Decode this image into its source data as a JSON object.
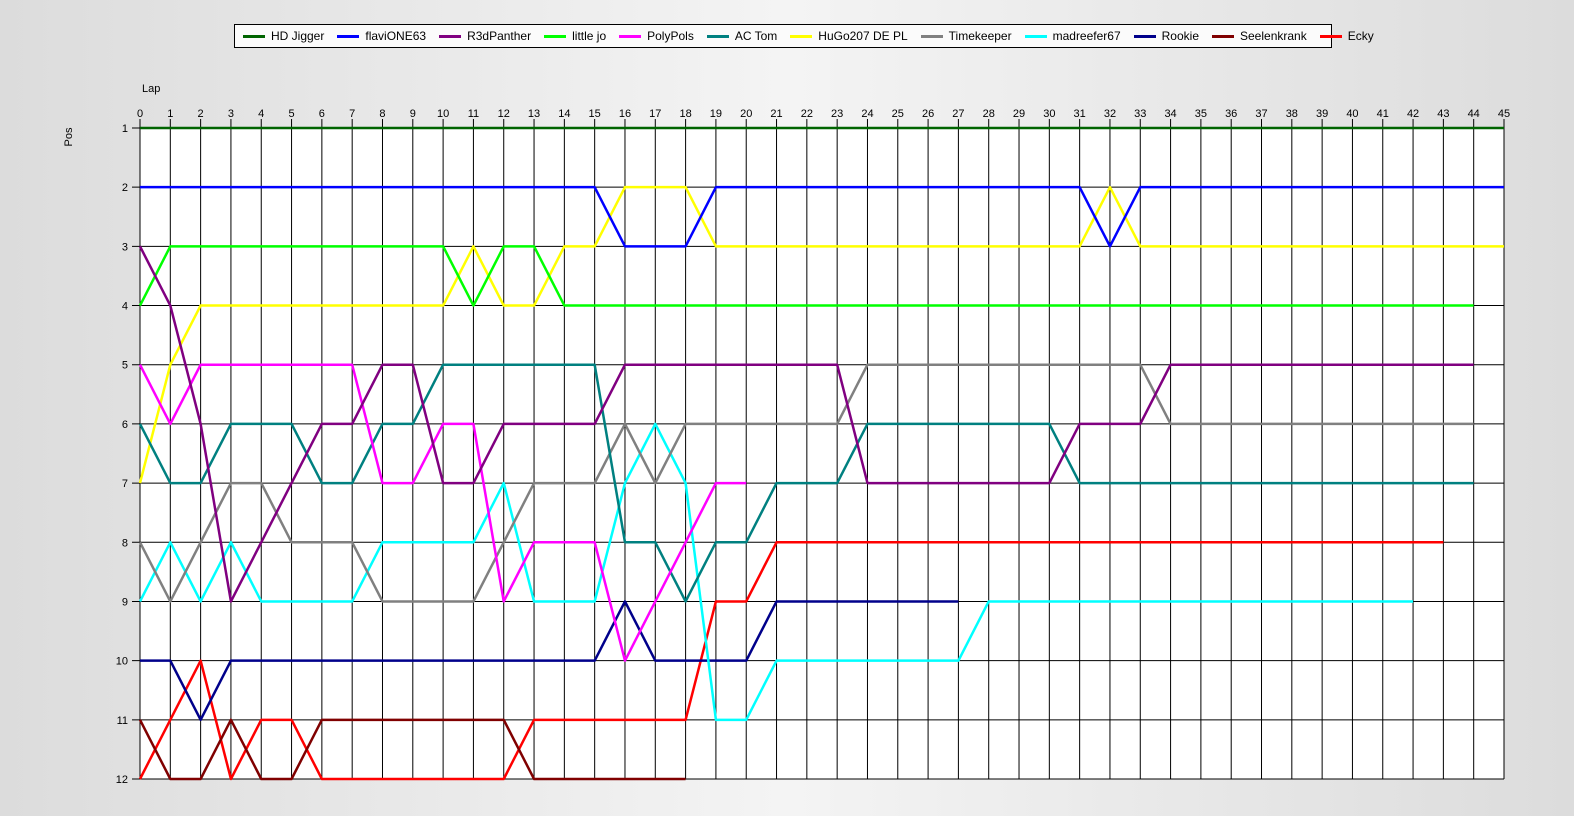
{
  "chart_data": {
    "type": "line",
    "title": "",
    "xlabel": "Lap",
    "ylabel": "Pos",
    "xlim": [
      0,
      45
    ],
    "ylim": [
      1,
      12
    ],
    "y_reversed": true,
    "grid": true,
    "legend_position": "top",
    "x_ticks": [
      0,
      1,
      2,
      3,
      4,
      5,
      6,
      7,
      8,
      9,
      10,
      11,
      12,
      13,
      14,
      15,
      16,
      17,
      18,
      19,
      20,
      21,
      22,
      23,
      24,
      25,
      26,
      27,
      28,
      29,
      30,
      31,
      32,
      33,
      34,
      35,
      36,
      37,
      38,
      39,
      40,
      41,
      42,
      43,
      44,
      45
    ],
    "y_ticks": [
      1,
      2,
      3,
      4,
      5,
      6,
      7,
      8,
      9,
      10,
      11,
      12
    ],
    "series": [
      {
        "name": "HD Jigger",
        "color": "#006400",
        "values": [
          1,
          1,
          1,
          1,
          1,
          1,
          1,
          1,
          1,
          1,
          1,
          1,
          1,
          1,
          1,
          1,
          1,
          1,
          1,
          1,
          1,
          1,
          1,
          1,
          1,
          1,
          1,
          1,
          1,
          1,
          1,
          1,
          1,
          1,
          1,
          1,
          1,
          1,
          1,
          1,
          1,
          1,
          1,
          1,
          1,
          1
        ]
      },
      {
        "name": "flaviONE63",
        "color": "#0000ff",
        "values": [
          2,
          2,
          2,
          2,
          2,
          2,
          2,
          2,
          2,
          2,
          2,
          2,
          2,
          2,
          2,
          2,
          3,
          3,
          3,
          2,
          2,
          2,
          2,
          2,
          2,
          2,
          2,
          2,
          2,
          2,
          2,
          2,
          3,
          2,
          2,
          2,
          2,
          2,
          2,
          2,
          2,
          2,
          2,
          2,
          2,
          2
        ]
      },
      {
        "name": "R3dPanther",
        "color": "#800080",
        "values": [
          3,
          4,
          6,
          9,
          8,
          7,
          6,
          6,
          5,
          5,
          7,
          7,
          6,
          6,
          6,
          6,
          5,
          5,
          5,
          5,
          5,
          5,
          5,
          5,
          7,
          7,
          7,
          7,
          7,
          7,
          7,
          6,
          6,
          6,
          5,
          5,
          5,
          5,
          5,
          5,
          5,
          5,
          5,
          5,
          5
        ]
      },
      {
        "name": "little jo",
        "color": "#00ff00",
        "values": [
          4,
          3,
          3,
          3,
          3,
          3,
          3,
          3,
          3,
          3,
          3,
          4,
          3,
          3,
          4,
          4,
          4,
          4,
          4,
          4,
          4,
          4,
          4,
          4,
          4,
          4,
          4,
          4,
          4,
          4,
          4,
          4,
          4,
          4,
          4,
          4,
          4,
          4,
          4,
          4,
          4,
          4,
          4,
          4,
          4
        ]
      },
      {
        "name": "PolyPols",
        "color": "#ff00ff",
        "values": [
          5,
          6,
          5,
          5,
          5,
          5,
          5,
          5,
          7,
          7,
          6,
          6,
          9,
          8,
          8,
          8,
          10,
          9,
          8,
          7,
          7
        ]
      },
      {
        "name": "AC Tom",
        "color": "#008080",
        "values": [
          6,
          7,
          7,
          6,
          6,
          6,
          7,
          7,
          6,
          6,
          5,
          5,
          5,
          5,
          5,
          5,
          8,
          8,
          9,
          8,
          8,
          7,
          7,
          7,
          6,
          6,
          6,
          6,
          6,
          6,
          6,
          7,
          7,
          7,
          7,
          7,
          7,
          7,
          7,
          7,
          7,
          7,
          7,
          7,
          7
        ]
      },
      {
        "name": "HuGo207 DE PL",
        "color": "#ffff00",
        "values": [
          7,
          5,
          4,
          4,
          4,
          4,
          4,
          4,
          4,
          4,
          4,
          3,
          4,
          4,
          3,
          3,
          2,
          2,
          2,
          3,
          3,
          3,
          3,
          3,
          3,
          3,
          3,
          3,
          3,
          3,
          3,
          3,
          2,
          3,
          3,
          3,
          3,
          3,
          3,
          3,
          3,
          3,
          3,
          3,
          3,
          3
        ]
      },
      {
        "name": "Timekeeper",
        "color": "#808080",
        "values": [
          8,
          9,
          8,
          7,
          7,
          8,
          8,
          8,
          9,
          9,
          9,
          9,
          8,
          7,
          7,
          7,
          6,
          7,
          6,
          6,
          6,
          6,
          6,
          6,
          5,
          5,
          5,
          5,
          5,
          5,
          5,
          5,
          5,
          5,
          6,
          6,
          6,
          6,
          6,
          6,
          6,
          6,
          6,
          6,
          6
        ]
      },
      {
        "name": "madreefer67",
        "color": "#00ffff",
        "values": [
          9,
          8,
          9,
          8,
          9,
          9,
          9,
          9,
          8,
          8,
          8,
          8,
          7,
          9,
          9,
          9,
          7,
          6,
          7,
          11,
          11,
          10,
          10,
          10,
          10,
          10,
          10,
          10,
          9,
          9,
          9,
          9,
          9,
          9,
          9,
          9,
          9,
          9,
          9,
          9,
          9,
          9,
          9
        ]
      },
      {
        "name": "Rookie",
        "color": "#00008b",
        "values": [
          10,
          10,
          11,
          10,
          10,
          10,
          10,
          10,
          10,
          10,
          10,
          10,
          10,
          10,
          10,
          10,
          9,
          10,
          10,
          10,
          10,
          9,
          9,
          9,
          9,
          9,
          9,
          9
        ]
      },
      {
        "name": "Seelenkrank",
        "color": "#800000",
        "values": [
          11,
          12,
          12,
          11,
          12,
          12,
          11,
          11,
          11,
          11,
          11,
          11,
          11,
          12,
          12,
          12,
          12,
          12,
          12
        ]
      },
      {
        "name": "Ecky",
        "color": "#ff0000",
        "values": [
          12,
          11,
          10,
          12,
          11,
          11,
          12,
          12,
          12,
          12,
          12,
          12,
          12,
          11,
          11,
          11,
          11,
          11,
          11,
          9,
          9,
          8,
          8,
          8,
          8,
          8,
          8,
          8,
          8,
          8,
          8,
          8,
          8,
          8,
          8,
          8,
          8,
          8,
          8,
          8,
          8,
          8,
          8,
          8
        ]
      }
    ]
  }
}
